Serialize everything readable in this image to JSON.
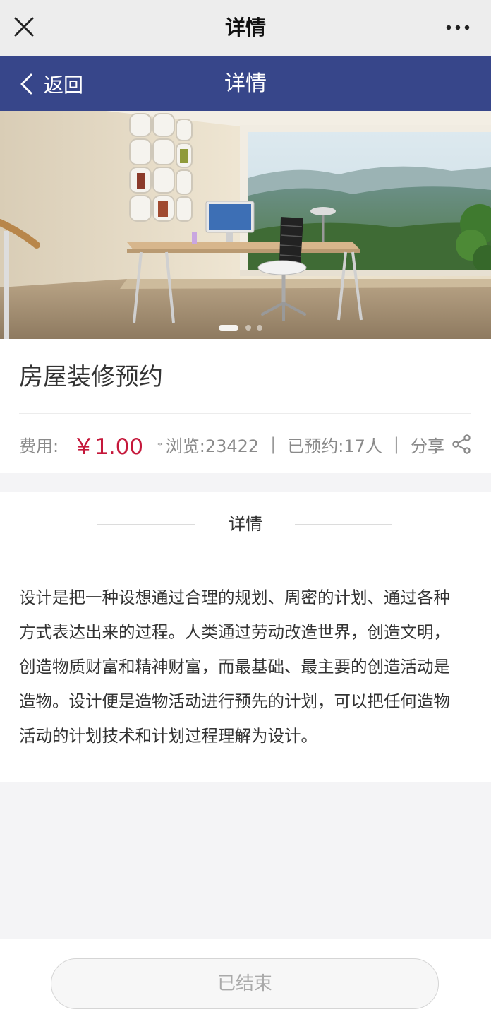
{
  "system_bar": {
    "title": "详情"
  },
  "nav_bar": {
    "back_label": "返回",
    "title": "详情"
  },
  "hero": {
    "carousel_dots": 3,
    "active_dot": 0
  },
  "product": {
    "title": "房屋装修预约",
    "fee_label": "费用:",
    "price": "￥1.00",
    "views": "浏览:23422",
    "separator": "|",
    "booked": "已预约:17人",
    "share_label": "分享"
  },
  "detail": {
    "section_title": "详情",
    "lines": [
      "设计是把一种设想通过合理的规划、周密的计划、通过各种",
      "方式表达出来的过程。人类通过劳动改造世界，创造文明，",
      "创造物质财富和精神财富，而最基础、最主要的创造活动是",
      "造物。设计便是造物活动进行预先的计划，可以把任何造物",
      "活动的计划技术和计划过程理解为设计。"
    ]
  },
  "footer": {
    "button_label": "已结束"
  },
  "colors": {
    "nav_bar_bg": "#37468a",
    "price_color": "#c5173a",
    "system_bar_bg": "#ededed",
    "page_bg": "#f4f4f6"
  }
}
